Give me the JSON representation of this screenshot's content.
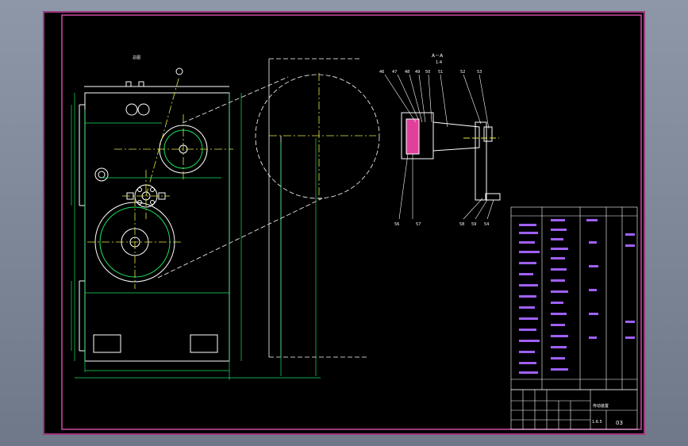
{
  "drawing": {
    "view_label": "总图",
    "section_title": "A－A",
    "section_scale": "1:4",
    "part_numbers_top": [
      "46",
      "47",
      "48",
      "49",
      "50",
      "51",
      "52",
      "53"
    ],
    "part_numbers_bottom": [
      "56",
      "57",
      "58",
      "59",
      "54"
    ],
    "drawing_title": "传动装置",
    "scale_value": "1:6.5",
    "sheet_number": "03",
    "colors": {
      "frame": "#d04aa8",
      "outline": "#ffffff",
      "dimension": "#18e060",
      "centerline": "#e8e840",
      "bom_text": "#a060ff",
      "sheet": "#000000"
    }
  }
}
